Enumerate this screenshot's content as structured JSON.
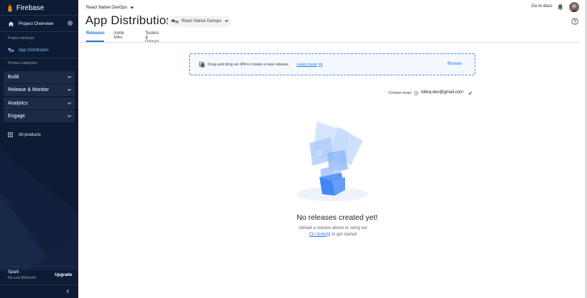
{
  "sidebar": {
    "brand": "Firebase",
    "project_overview": "Project Overview",
    "project_shortcuts_caption": "Project shortcuts",
    "shortcut_item": "App Distribution",
    "product_categories_caption": "Product categories",
    "categories": [
      {
        "label": "Build"
      },
      {
        "label": "Release & Monitor"
      },
      {
        "label": "Analytics"
      },
      {
        "label": "Engage"
      }
    ],
    "all_products": "All products",
    "plan_name": "Spark",
    "plan_sub": "No-cost $0/month",
    "upgrade": "Upgrade"
  },
  "topbar": {
    "project_selector": "React Native DevOps",
    "go_to_docs": "Go to docs"
  },
  "page": {
    "title": "App Distribution",
    "app_selector": "React Native Devops",
    "tabs": [
      {
        "label": "Releases",
        "active": true
      },
      {
        "label": "Invite links",
        "active": false
      },
      {
        "label": "Testers & Groups",
        "active": false
      }
    ]
  },
  "dropzone": {
    "text": "Drag and drop an IPA to create a new release.",
    "learn_more": "Learn more",
    "browse": "Browse"
  },
  "contact": {
    "label": "Contact email",
    "email": "tdduy.dev@gmail.com"
  },
  "empty_state": {
    "title": "No releases created yet!",
    "line1": "Upload a release above or using our",
    "cli_link": "CLI tools",
    "line2_suffix": "to get started"
  },
  "colors": {
    "sidebar_bg": "#0d1b35",
    "accent": "#1a73e8"
  }
}
